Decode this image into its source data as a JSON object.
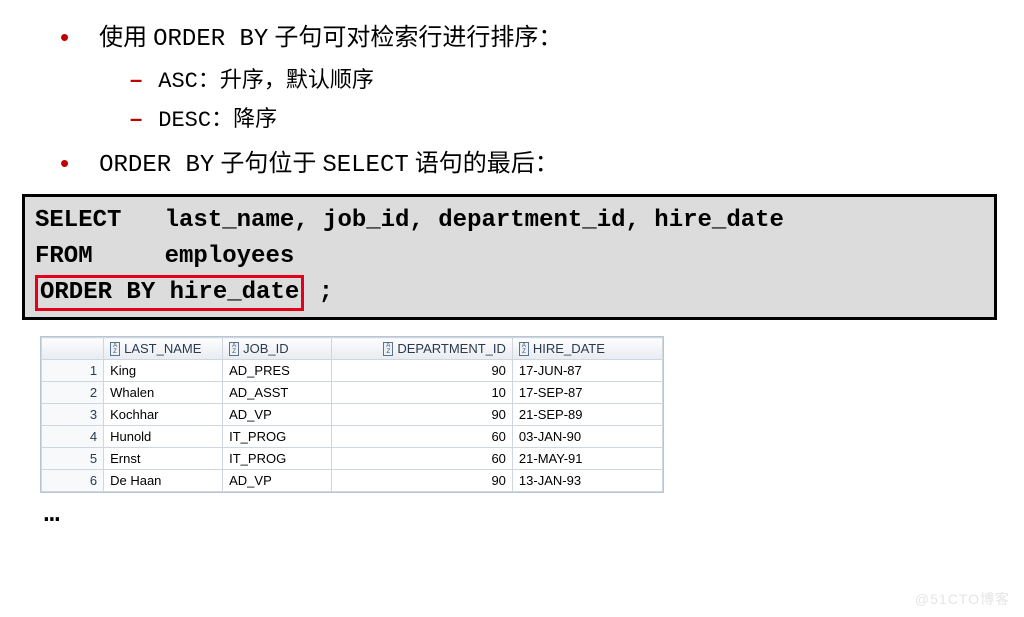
{
  "bullets": {
    "b1_pre": "使用 ",
    "b1_code": "ORDER BY",
    "b1_post": " 子句可对检索行进行排序：",
    "sub_asc_code": "ASC",
    "sub_asc_text": "：升序，默认顺序",
    "sub_desc_code": "DESC",
    "sub_desc_text": "：降序",
    "b2_code1": "ORDER BY",
    "b2_mid": " 子句位于 ",
    "b2_code2": "SELECT",
    "b2_post": " 语句的最后："
  },
  "code": {
    "line1": "SELECT   last_name, job_id, department_id, hire_date",
    "line2": "FROM     employees",
    "hl": "ORDER BY hire_date",
    "after_hl": " ;"
  },
  "table": {
    "headers": {
      "lastname": "LAST_NAME",
      "jobid": "JOB_ID",
      "dept": "DEPARTMENT_ID",
      "hire": "HIRE_DATE"
    },
    "rows": [
      {
        "n": "1",
        "ln": "King",
        "job": "AD_PRES",
        "dept": "90",
        "hire": "17-JUN-87"
      },
      {
        "n": "2",
        "ln": "Whalen",
        "job": "AD_ASST",
        "dept": "10",
        "hire": "17-SEP-87"
      },
      {
        "n": "3",
        "ln": "Kochhar",
        "job": "AD_VP",
        "dept": "90",
        "hire": "21-SEP-89"
      },
      {
        "n": "4",
        "ln": "Hunold",
        "job": "IT_PROG",
        "dept": "60",
        "hire": "03-JAN-90"
      },
      {
        "n": "5",
        "ln": "Ernst",
        "job": "IT_PROG",
        "dept": "60",
        "hire": "21-MAY-91"
      },
      {
        "n": "6",
        "ln": "De Haan",
        "job": "AD_VP",
        "dept": "90",
        "hire": "13-JAN-93"
      }
    ]
  },
  "ellipsis": "…",
  "watermark": "@51CTO博客"
}
